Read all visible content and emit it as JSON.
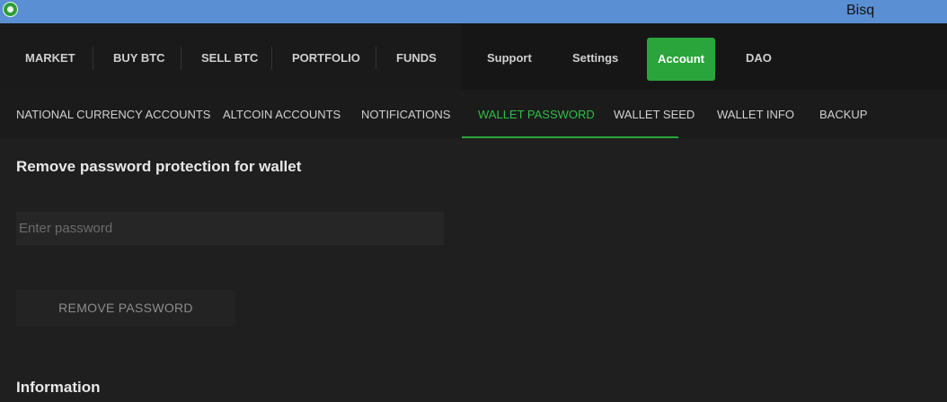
{
  "window": {
    "title": "Bisq",
    "logo_icon": "bisq-logo-icon"
  },
  "primary_nav": {
    "items": [
      {
        "label": "MARKET"
      },
      {
        "label": "BUY BTC"
      },
      {
        "label": "SELL BTC"
      },
      {
        "label": "PORTFOLIO"
      },
      {
        "label": "FUNDS"
      }
    ]
  },
  "secondary_nav": {
    "items": [
      {
        "label": "Support"
      },
      {
        "label": "Settings"
      },
      {
        "label": "Account",
        "active": true
      },
      {
        "label": "DAO"
      }
    ]
  },
  "account_tabs": {
    "items": [
      {
        "label": "NATIONAL CURRENCY ACCOUNTS"
      },
      {
        "label": "ALTCOIN ACCOUNTS"
      },
      {
        "label": "NOTIFICATIONS"
      },
      {
        "label": "WALLET PASSWORD",
        "active": true
      },
      {
        "label": "WALLET SEED"
      },
      {
        "label": "WALLET INFO"
      },
      {
        "label": "BACKUP"
      }
    ]
  },
  "wallet_password": {
    "title": "Remove password protection for wallet",
    "input_placeholder": "Enter password",
    "input_value": "",
    "button_label": "REMOVE PASSWORD",
    "info_title": "Information"
  },
  "colors": {
    "accent": "#2aa53c",
    "titlebar": "#5a8fd4",
    "background": "#1f1f1f"
  }
}
